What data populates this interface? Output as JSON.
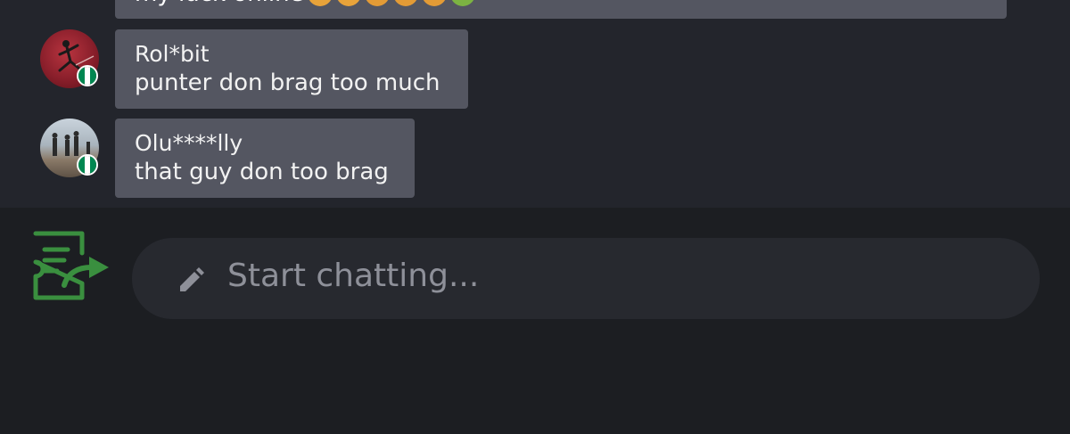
{
  "top_message": {
    "text": "my luck online"
  },
  "messages": [
    {
      "name": "Rol*bit",
      "text": "punter don brag too much"
    },
    {
      "name": "Olu****lly",
      "text": "that guy don too brag"
    }
  ],
  "composer": {
    "placeholder": "Start chatting..."
  },
  "icons": {
    "pencil": "pencil-icon",
    "bet_slip": "bet-slip-share-icon",
    "flag": "nigeria-flag-icon"
  },
  "colors": {
    "accent_green": "#3a8f3f",
    "bubble_bg": "#545661",
    "chat_bg": "#23252c",
    "footer_bg": "#1c1e22"
  }
}
